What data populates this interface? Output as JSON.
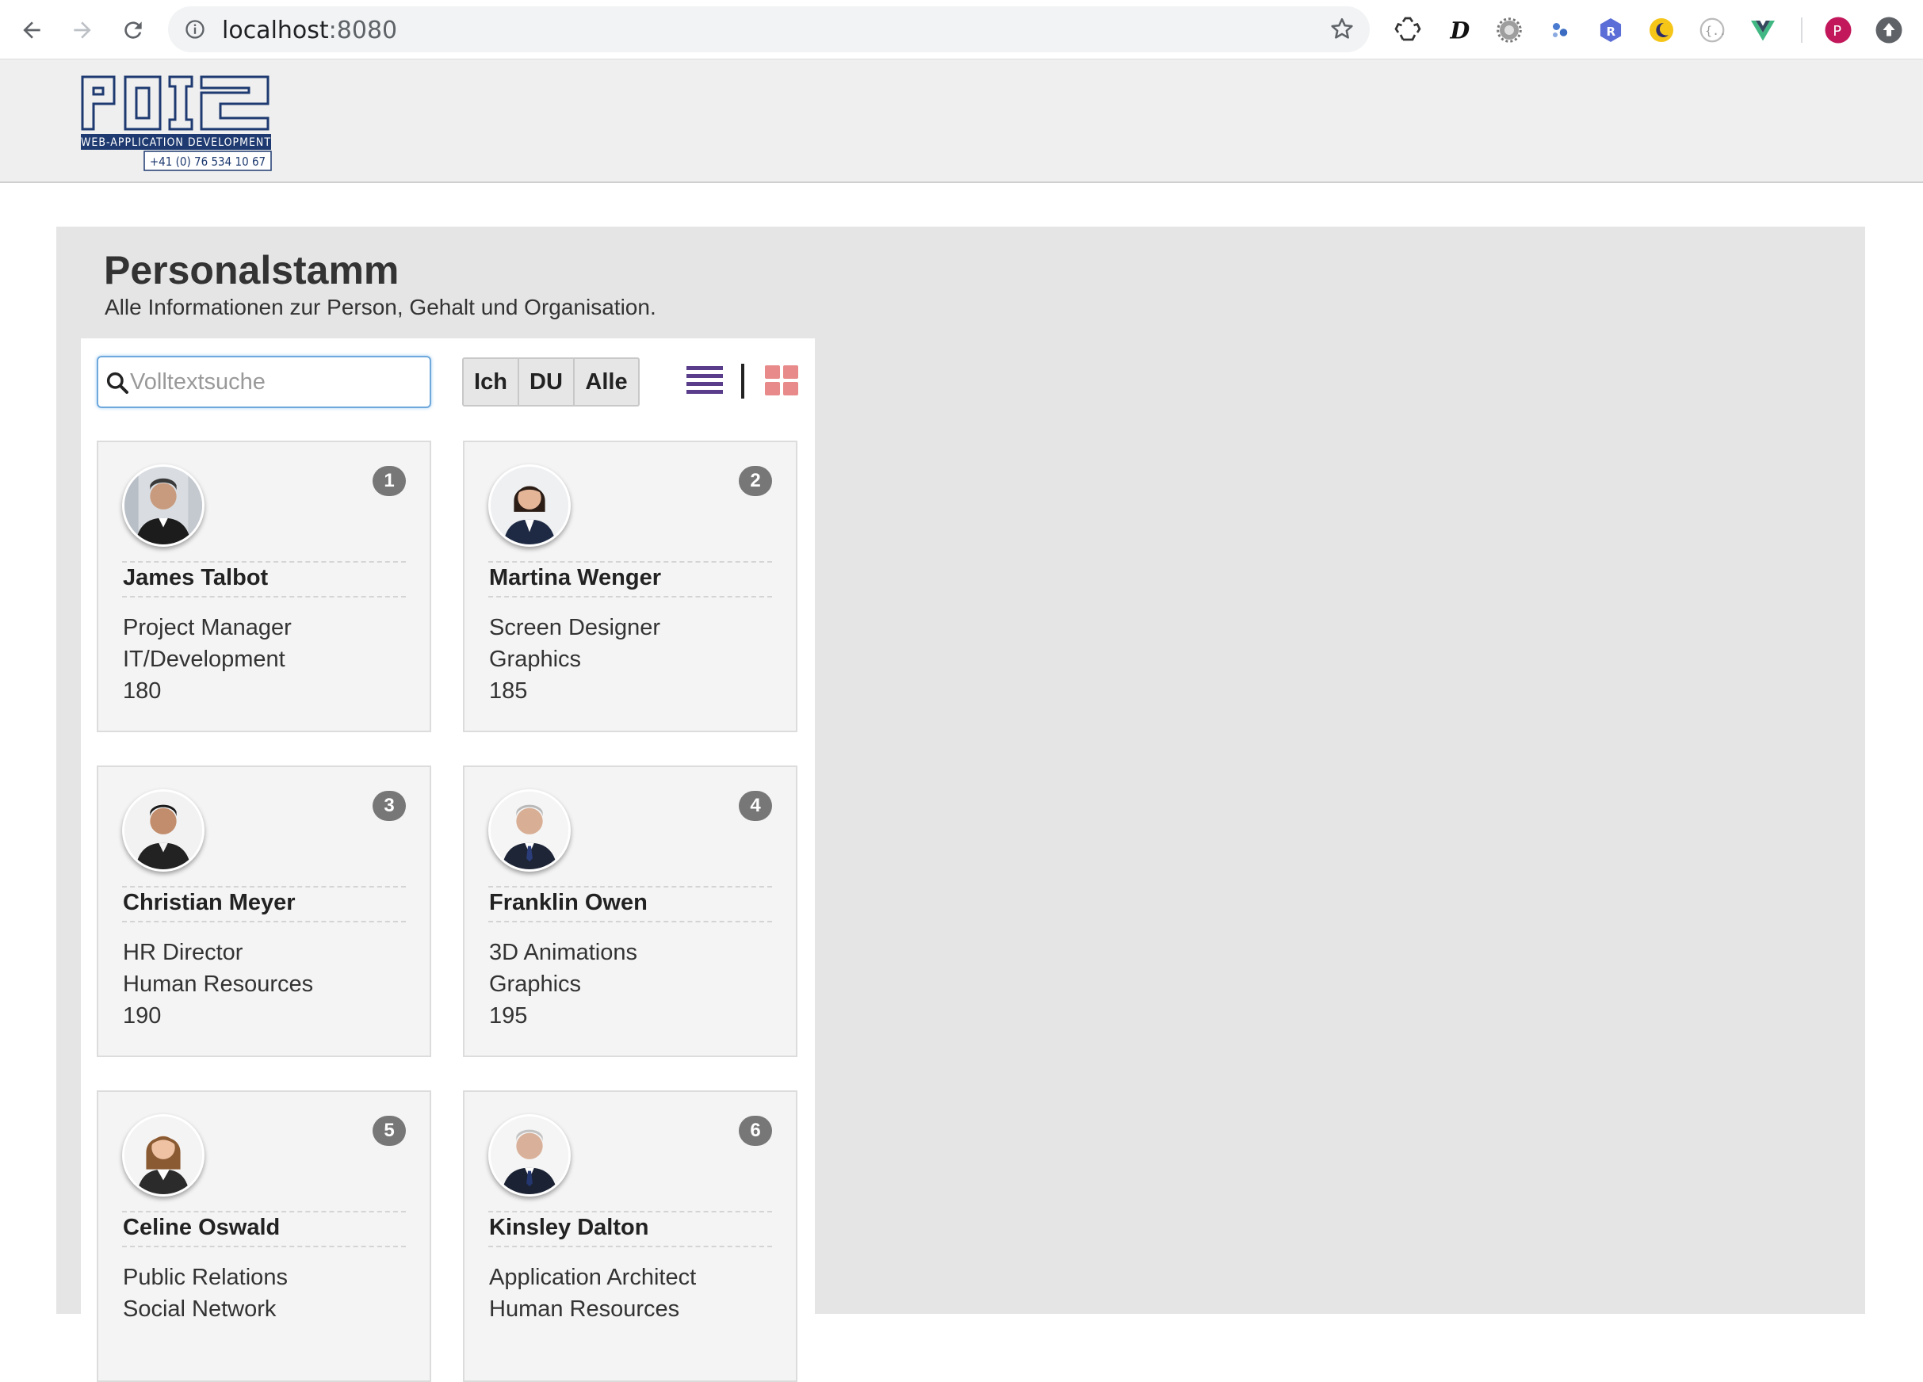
{
  "browser": {
    "url_host": "localhost",
    "url_port": ":8080",
    "profile_initial": "P"
  },
  "logo": {
    "brand": "POI2",
    "tagline": "WEB-APPLICATION DEVELOPMENT",
    "phone": "+41 (0) 76 534 10 67"
  },
  "page": {
    "title": "Personalstamm",
    "subtitle": "Alle Informationen zur Person, Gehalt und Organisation."
  },
  "search": {
    "placeholder": "Volltextsuche",
    "value": ""
  },
  "filters": [
    {
      "label": "Ich"
    },
    {
      "label": "DU"
    },
    {
      "label": "Alle"
    }
  ],
  "colors": {
    "list_icon": "#5a3d8a",
    "grid_icon": "#e88a8a",
    "badge": "#777777"
  },
  "people": [
    {
      "id": "1",
      "name": "James Talbot",
      "role": "Project Manager",
      "department": "IT/Development",
      "number": "180",
      "avatar": "man-suit-avatar"
    },
    {
      "id": "2",
      "name": "Martina Wenger",
      "role": "Screen Designer",
      "department": "Graphics",
      "number": "185",
      "avatar": "woman-suit-avatar"
    },
    {
      "id": "3",
      "name": "Christian Meyer",
      "role": "HR Director",
      "department": "Human Resources",
      "number": "190",
      "avatar": "man-suit-avatar"
    },
    {
      "id": "4",
      "name": "Franklin Owen",
      "role": "3D Animations",
      "department": "Graphics",
      "number": "195",
      "avatar": "grey-hair-man-avatar"
    },
    {
      "id": "5",
      "name": "Celine Oswald",
      "role": "Public Relations",
      "department": "Social Network",
      "number": "",
      "avatar": "woman-avatar"
    },
    {
      "id": "6",
      "name": "Kinsley Dalton",
      "role": "Application Architect",
      "department": "Human Resources",
      "number": "",
      "avatar": "grey-hair-man-avatar"
    }
  ]
}
